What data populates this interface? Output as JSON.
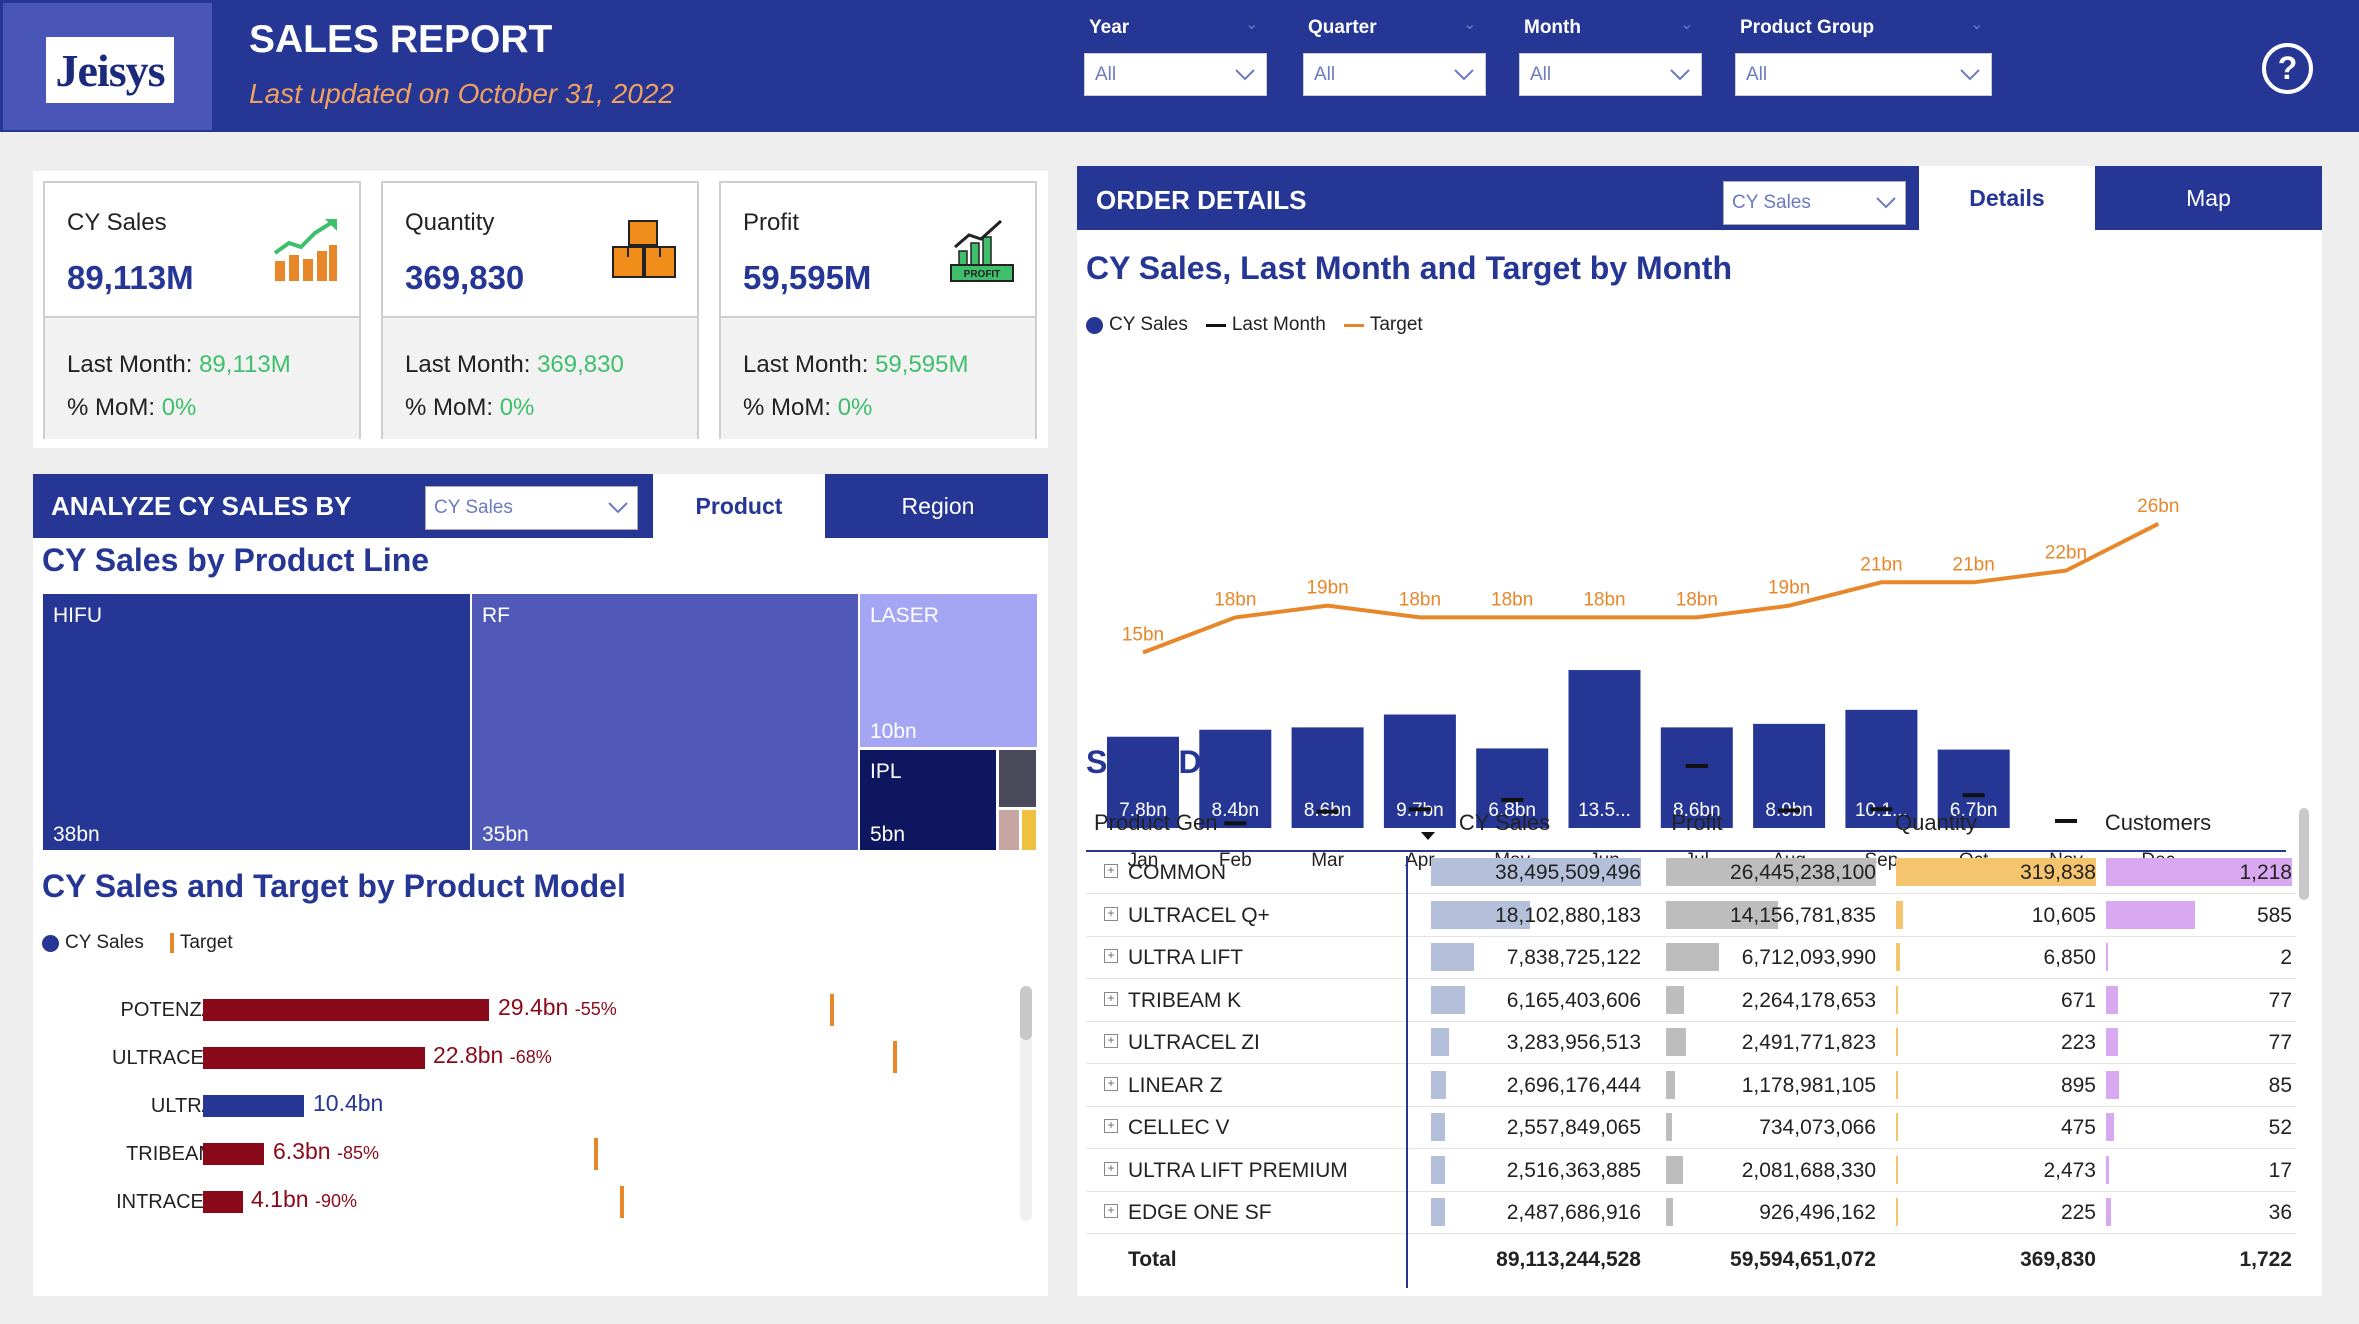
{
  "header": {
    "logo": "Jeisys",
    "title": "SALES REPORT",
    "subtitle": "Last updated on October 31, 2022",
    "slicers": [
      {
        "label": "Year",
        "value": "All"
      },
      {
        "label": "Quarter",
        "value": "All"
      },
      {
        "label": "Month",
        "value": "All"
      },
      {
        "label": "Product Group",
        "value": "All"
      }
    ],
    "help_icon": "question-circle-icon"
  },
  "kpis": [
    {
      "label": "CY Sales",
      "value": "89,113M",
      "last_month_label": "Last Month:",
      "last_month": "89,113M",
      "mom_label": "% MoM:",
      "mom": "0%",
      "icon": "growth-chart-icon"
    },
    {
      "label": "Quantity",
      "value": "369,830",
      "last_month_label": "Last Month:",
      "last_month": "369,830",
      "mom_label": "% MoM:",
      "mom": "0%",
      "icon": "boxes-icon"
    },
    {
      "label": "Profit",
      "value": "59,595M",
      "last_month_label": "Last Month:",
      "last_month": "59,595M",
      "mom_label": "% MoM:",
      "mom": "0%",
      "icon": "profit-icon",
      "icon_text": "PROFIT"
    }
  ],
  "analyze": {
    "title": "ANALYZE CY SALES BY",
    "dropdown": "CY Sales",
    "tabs": [
      {
        "label": "Product",
        "active": true
      },
      {
        "label": "Region",
        "active": false
      }
    ]
  },
  "treemap": {
    "title": "CY Sales by Product Line",
    "items": [
      {
        "name": "HIFU",
        "value": "38bn",
        "color": "#253695"
      },
      {
        "name": "RF",
        "value": "35bn",
        "color": "#5159b8"
      },
      {
        "name": "LASER",
        "value": "10bn",
        "color": "#a4a6f4"
      },
      {
        "name": "IPL",
        "value": "5bn",
        "color": "#0e1660"
      }
    ],
    "small_colors": [
      "#4a4a5a",
      "#c7a5a0",
      "#f0c040"
    ]
  },
  "product_model": {
    "title": "CY Sales and Target by Product Model",
    "legend": [
      "CY Sales",
      "Target"
    ],
    "items": [
      {
        "name": "POTENZA",
        "value": "29.4bn",
        "pct": "-55%",
        "color": "#8b0a1a"
      },
      {
        "name": "ULTRACEL",
        "value": "22.8bn",
        "pct": "-68%",
        "color": "#8b0a1a"
      },
      {
        "name": "ULTRA",
        "value": "10.4bn",
        "pct": "",
        "color": "#253695"
      },
      {
        "name": "TRIBEAM",
        "value": "6.3bn",
        "pct": "-85%",
        "color": "#8b0a1a"
      },
      {
        "name": "INTRACEL",
        "value": "4.1bn",
        "pct": "-90%",
        "color": "#8b0a1a"
      }
    ]
  },
  "order_details": {
    "title": "ORDER DETAILS",
    "dropdown": "CY Sales",
    "tabs": [
      {
        "label": "Details",
        "active": true
      },
      {
        "label": "Map",
        "active": false
      }
    ]
  },
  "monthly_chart": {
    "title": "CY Sales, Last Month and Target by Month",
    "legend": [
      "CY Sales",
      "Last Month",
      "Target"
    ]
  },
  "chart_data": {
    "type": "bar",
    "title": "CY Sales, Last Month and Target by Month",
    "categories": [
      "Jan",
      "Feb",
      "Mar",
      "Apr",
      "May",
      "Jun",
      "Jul",
      "Aug",
      "Sep",
      "Oct",
      "Nov",
      "Dec"
    ],
    "series": [
      {
        "name": "CY Sales",
        "type": "bar",
        "values": [
          7.8,
          8.4,
          8.6,
          9.7,
          6.8,
          13.5,
          8.6,
          8.9,
          10.1,
          6.7,
          null,
          null
        ],
        "labels": [
          "7.8bn",
          "8.4bn",
          "8.6bn",
          "9.7bn",
          "6.8bn",
          "13.5...",
          "8.6bn",
          "8.9bn",
          "10.1...",
          "6.7bn",
          "",
          ""
        ]
      },
      {
        "name": "Last Month",
        "type": "marker",
        "values": [
          null,
          0.4,
          1.4,
          1.6,
          2.4,
          null,
          5.3,
          1.5,
          1.6,
          2.8,
          0.6,
          null
        ]
      },
      {
        "name": "Target",
        "type": "line",
        "values": [
          15,
          18,
          19,
          18,
          18,
          18,
          18,
          19,
          21,
          21,
          22,
          26
        ],
        "labels": [
          "15bn",
          "18bn",
          "19bn",
          "18bn",
          "18bn",
          "18bn",
          "18bn",
          "19bn",
          "21bn",
          "21bn",
          "22bn",
          "26bn"
        ]
      }
    ],
    "ylim": [
      0,
      30
    ]
  },
  "sales_detail": {
    "title": "Sales Detail",
    "columns": [
      "Product Gen",
      "CY Sales",
      "Profit",
      "Quantity",
      "Customers"
    ],
    "rows": [
      {
        "name": "COMMON",
        "sales": "38,495,509,496",
        "profit": "26,445,238,100",
        "qty": "319,838",
        "cust": "1,218",
        "sales_v": 38495509496,
        "profit_v": 26445238100,
        "qty_v": 319838,
        "cust_v": 1218
      },
      {
        "name": "ULTRACEL Q+",
        "sales": "18,102,880,183",
        "profit": "14,156,781,835",
        "qty": "10,605",
        "cust": "585",
        "sales_v": 18102880183,
        "profit_v": 14156781835,
        "qty_v": 10605,
        "cust_v": 585
      },
      {
        "name": "ULTRA LIFT",
        "sales": "7,838,725,122",
        "profit": "6,712,093,990",
        "qty": "6,850",
        "cust": "2",
        "sales_v": 7838725122,
        "profit_v": 6712093990,
        "qty_v": 6850,
        "cust_v": 2
      },
      {
        "name": "TRIBEAM K",
        "sales": "6,165,403,606",
        "profit": "2,264,178,653",
        "qty": "671",
        "cust": "77",
        "sales_v": 6165403606,
        "profit_v": 2264178653,
        "qty_v": 671,
        "cust_v": 77
      },
      {
        "name": "ULTRACEL ZI",
        "sales": "3,283,956,513",
        "profit": "2,491,771,823",
        "qty": "223",
        "cust": "77",
        "sales_v": 3283956513,
        "profit_v": 2491771823,
        "qty_v": 223,
        "cust_v": 77
      },
      {
        "name": "LINEAR Z",
        "sales": "2,696,176,444",
        "profit": "1,178,981,105",
        "qty": "895",
        "cust": "85",
        "sales_v": 2696176444,
        "profit_v": 1178981105,
        "qty_v": 895,
        "cust_v": 85
      },
      {
        "name": "CELLEC V",
        "sales": "2,557,849,065",
        "profit": "734,073,066",
        "qty": "475",
        "cust": "52",
        "sales_v": 2557849065,
        "profit_v": 734073066,
        "qty_v": 475,
        "cust_v": 52
      },
      {
        "name": "ULTRA LIFT PREMIUM",
        "sales": "2,516,363,885",
        "profit": "2,081,688,330",
        "qty": "2,473",
        "cust": "17",
        "sales_v": 2516363885,
        "profit_v": 2081688330,
        "qty_v": 2473,
        "cust_v": 17
      },
      {
        "name": "EDGE ONE SF",
        "sales": "2,487,686,916",
        "profit": "926,496,162",
        "qty": "225",
        "cust": "36",
        "sales_v": 2487686916,
        "profit_v": 926496162,
        "qty_v": 225,
        "cust_v": 36
      }
    ],
    "total": {
      "label": "Total",
      "sales": "89,113,244,528",
      "profit": "59,594,651,072",
      "qty": "369,830",
      "cust": "1,722"
    }
  },
  "colors": {
    "brand": "#253695",
    "accent_orange": "#e8862a",
    "positive": "#3fbf6c",
    "negative": "#8b0a1a"
  }
}
